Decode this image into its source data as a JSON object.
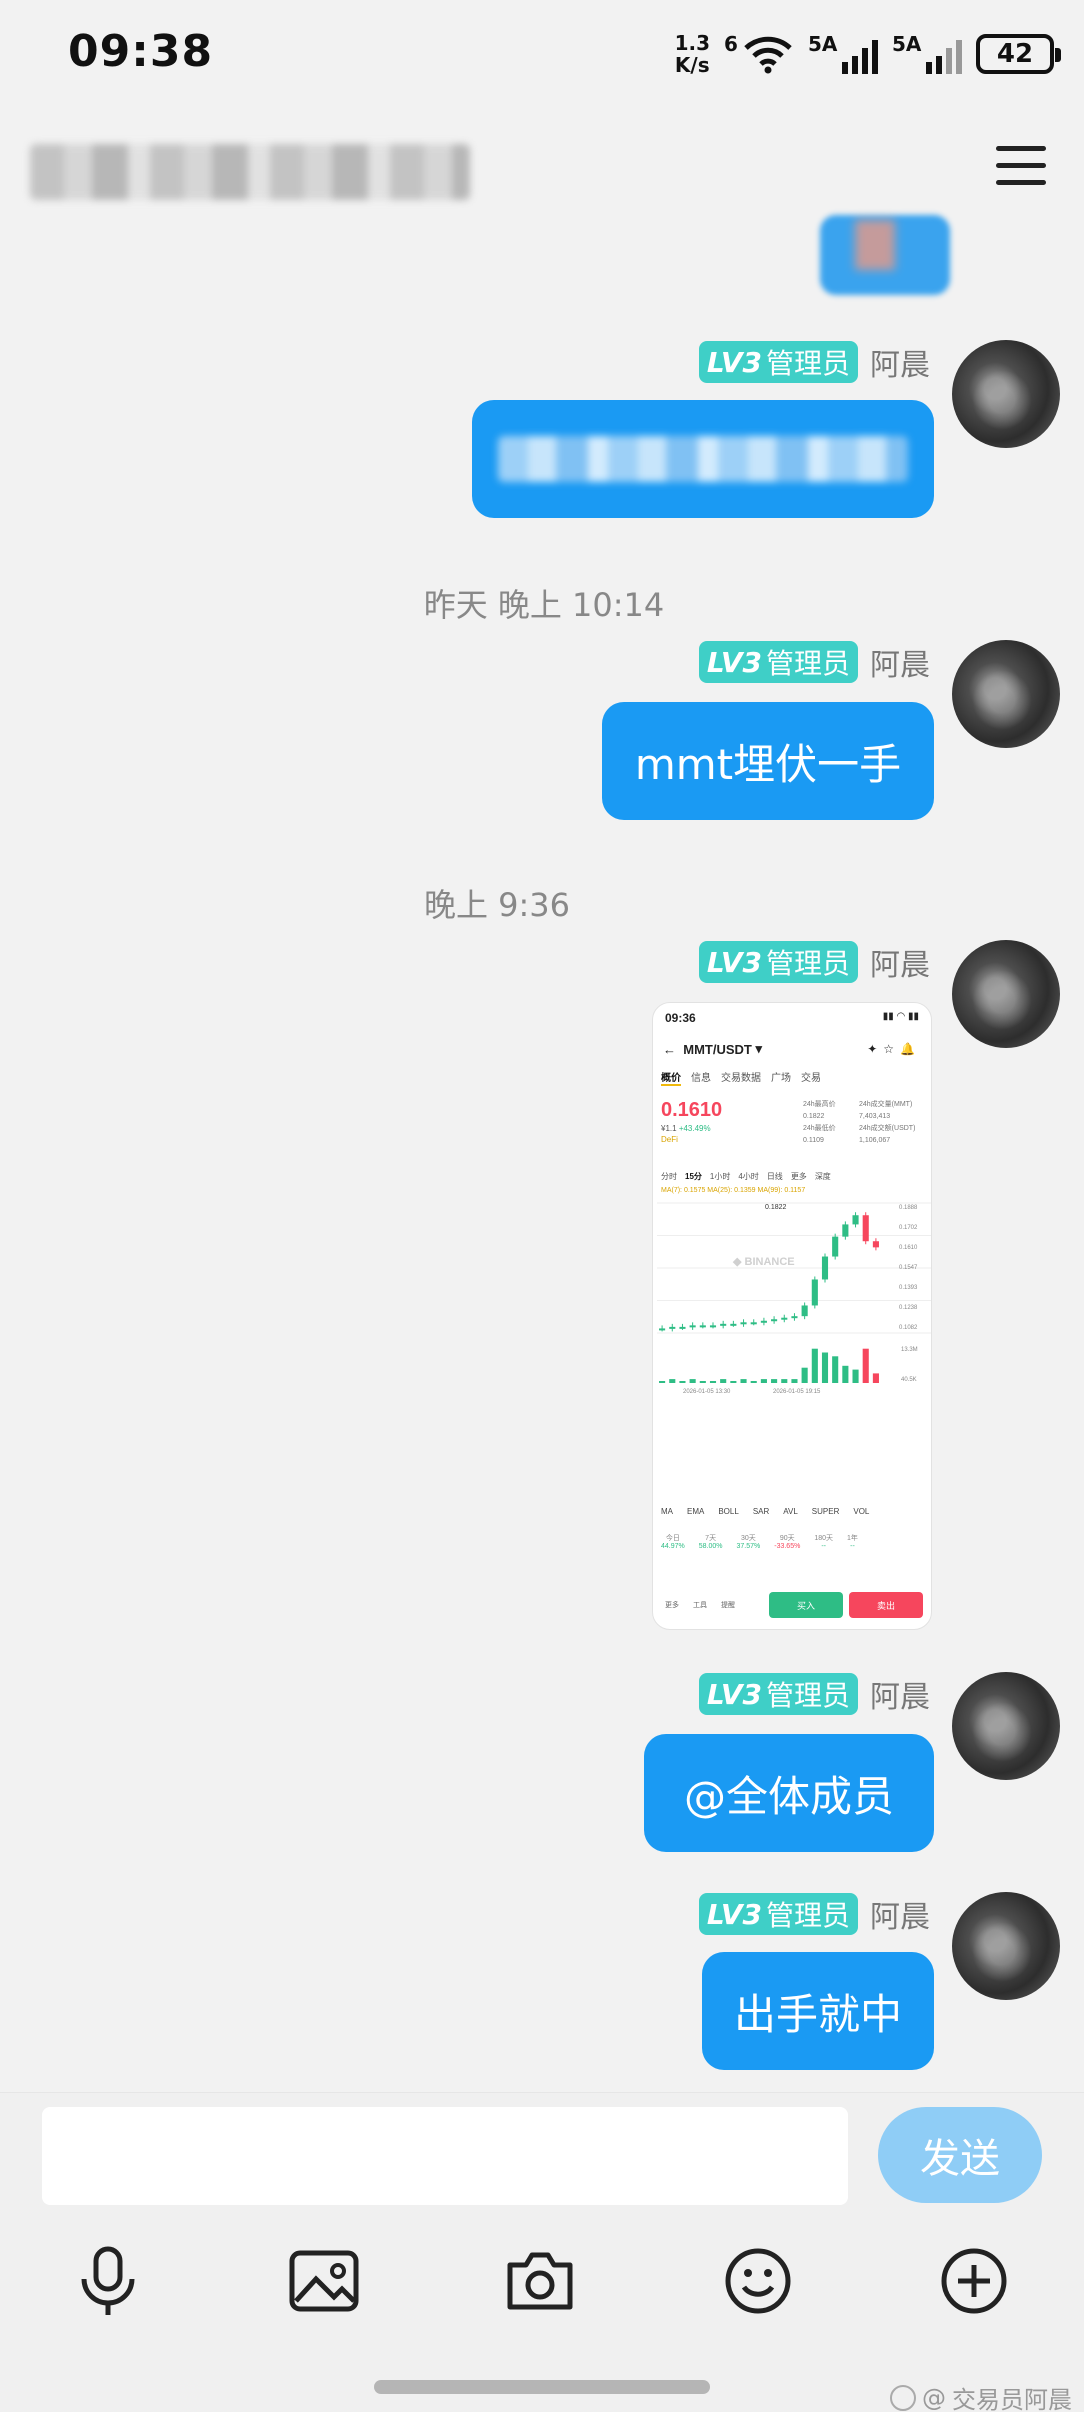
{
  "status_bar": {
    "time": "09:38",
    "net_speed_value": "1.3",
    "net_speed_unit": "K/s",
    "wifi_label": "6",
    "sim1_label": "5A",
    "sim2_label": "5A",
    "battery": "42"
  },
  "chat": {
    "messages": [
      {
        "badge_level": "LV3",
        "badge_role": "管理员",
        "sender": "阿晨",
        "text": ""
      },
      {
        "timestamp": "昨天 晚上 10:14",
        "badge_level": "LV3",
        "badge_role": "管理员",
        "sender": "阿晨",
        "text": "mmt埋伏一手"
      },
      {
        "timestamp": "晚上 9:36",
        "badge_level": "LV3",
        "badge_role": "管理员",
        "sender": "阿晨",
        "type": "image"
      },
      {
        "badge_level": "LV3",
        "badge_role": "管理员",
        "sender": "阿晨",
        "text": "@全体成员"
      },
      {
        "badge_level": "LV3",
        "badge_role": "管理员",
        "sender": "阿晨",
        "text": "出手就中"
      }
    ]
  },
  "screenshot": {
    "time": "09:36",
    "pair": "MMT/USDT",
    "tabs": [
      "概价",
      "信息",
      "交易数据",
      "广场",
      "交易"
    ],
    "price": "0.1610",
    "sub_price": "¥1.1",
    "change": "+43.49%",
    "tag": "DeFi",
    "stats": [
      "24h最高价",
      "24h成交量(MMT)",
      "0.1822",
      "7,403,413",
      "24h最低价",
      "24h成交额(USDT)",
      "0.1109",
      "1,106,067"
    ],
    "intervals": [
      "分时",
      "15分",
      "1小时",
      "4小时",
      "日线",
      "更多",
      "深度"
    ],
    "ma_line": "MA(7): 0.1575  MA(25): 0.1359  MA(99): 0.1157",
    "watermark": "BINANCE",
    "high_label": "0.1822",
    "price_ticks": [
      "0.1888",
      "0.1702",
      "0.1610",
      "0.1547",
      "0.1393",
      "0.1238",
      "0.1082"
    ],
    "chart_data": {
      "type": "candlestick",
      "closes": [
        0.108,
        0.109,
        0.109,
        0.11,
        0.11,
        0.11,
        0.111,
        0.111,
        0.112,
        0.112,
        0.113,
        0.114,
        0.115,
        0.116,
        0.123,
        0.14,
        0.155,
        0.168,
        0.176,
        0.182,
        0.165,
        0.161
      ]
    },
    "date_labels": [
      "2026-01-05 13:30",
      "2026-01-05 19:15"
    ],
    "vol_ticks": [
      "13.3M",
      "40.5K"
    ],
    "indicators": [
      "MA",
      "EMA",
      "BOLL",
      "SAR",
      "AVL",
      "SUPER",
      "VOL"
    ],
    "perf": [
      {
        "label": "今日",
        "value": "44.97%"
      },
      {
        "label": "7天",
        "value": "58.00%"
      },
      {
        "label": "30天",
        "value": "37.57%"
      },
      {
        "label": "90天",
        "value": "-33.65%"
      },
      {
        "label": "180天",
        "value": "--"
      },
      {
        "label": "1年",
        "value": "--"
      }
    ],
    "bottom_items": [
      "更多",
      "工具",
      "提醒"
    ],
    "buy": "买入",
    "sell": "卖出"
  },
  "input": {
    "placeholder": "",
    "send_label": "发送"
  },
  "toolbar": {
    "icons": [
      "microphone-icon",
      "image-icon",
      "camera-icon",
      "emoji-icon",
      "plus-icon"
    ]
  },
  "watermark": "交易员阿晨",
  "colors": {
    "bubble": "#1a9af3",
    "badge": "#3fcfc7",
    "send": "#8fcdf6",
    "background": "#f2f2f2"
  }
}
